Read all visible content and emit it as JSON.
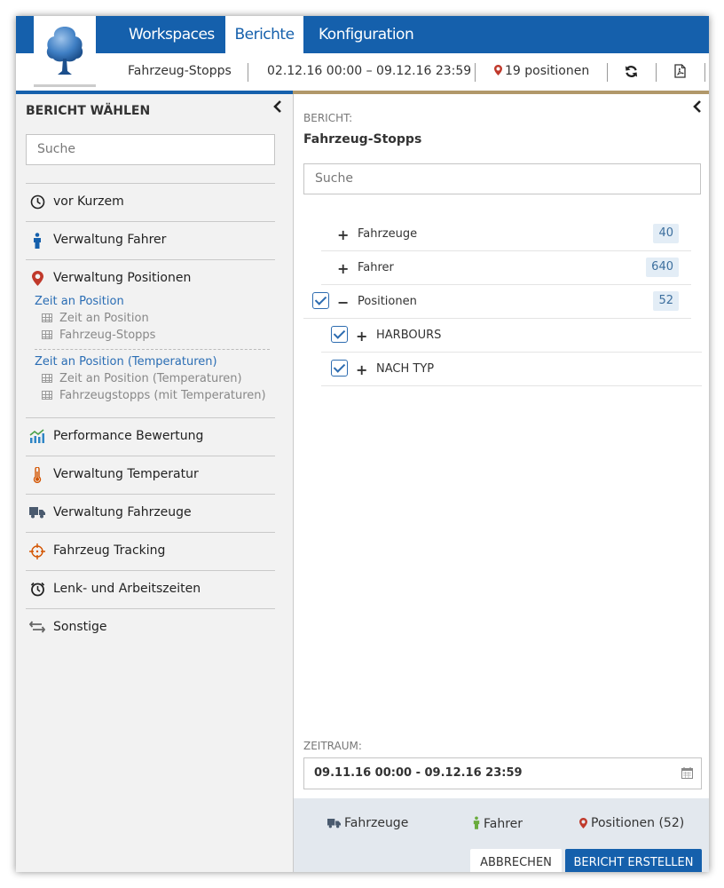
{
  "header": {
    "tabs": [
      {
        "label": "Workspaces"
      },
      {
        "label": "Berichte"
      },
      {
        "label": "Konfiguration"
      }
    ],
    "report_name": "Fahrzeug-Stopps",
    "date_range": "02.12.16 00:00 – 09.12.16 23:59",
    "positions": "19 positionen"
  },
  "left": {
    "title": "BERICHT WÄHLEN",
    "search_placeholder": "Suche",
    "menu": [
      {
        "label": "vor Kurzem",
        "icon": "clock-icon"
      },
      {
        "label": "Verwaltung Fahrer",
        "icon": "person-icon"
      },
      {
        "label": "Verwaltung Positionen",
        "icon": "map-pin-icon"
      },
      {
        "label": "Performance Bewertung",
        "icon": "chart-icon"
      },
      {
        "label": "Verwaltung Temperatur",
        "icon": "thermometer-icon"
      },
      {
        "label": "Verwaltung Fahrzeuge",
        "icon": "truck-icon"
      },
      {
        "label": "Fahrzeug Tracking",
        "icon": "crosshair-icon"
      },
      {
        "label": "Lenk- und Arbeitszeiten",
        "icon": "clock-alarm-icon"
      },
      {
        "label": "Sonstige",
        "icon": "arrows-icon"
      }
    ],
    "groups": [
      {
        "title": "Zeit an Position",
        "items": [
          "Zeit an Position",
          "Fahrzeug-Stopps"
        ]
      },
      {
        "title": "Zeit an Position (Temperaturen)",
        "items": [
          "Zeit an Position (Temperaturen)",
          "Fahrzeugstopps (mit Temperaturen)"
        ]
      }
    ]
  },
  "right": {
    "report_label": "BERICHT:",
    "report_title": "Fahrzeug-Stopps",
    "search_placeholder": "Suche",
    "tree": [
      {
        "label": "Fahrzeuge",
        "count": "40",
        "expander": "+"
      },
      {
        "label": "Fahrer",
        "count": "640",
        "expander": "+"
      },
      {
        "label": "Positionen",
        "count": "52",
        "expander": "−",
        "checked": true
      },
      {
        "label": "HARBOURS",
        "expander": "+",
        "checked": true
      },
      {
        "label": "NACH TYP",
        "expander": "+",
        "checked": true
      }
    ],
    "zeitraum_label": "ZEITRAUM:",
    "zeitraum_value": "09.11.16 00:00 - 09.12.16 23:59",
    "summary": {
      "vehicles": "Fahrzeuge",
      "drivers": "Fahrer",
      "positions": "Positionen (52)"
    },
    "cancel_label": "ABBRECHEN",
    "create_label": "BERICHT ERSTELLEN"
  },
  "colors": {
    "brand_blue": "#1560ac",
    "accent_gold": "#b1986a",
    "pin_red": "#c0392b",
    "driver_green": "#6aab3c"
  }
}
